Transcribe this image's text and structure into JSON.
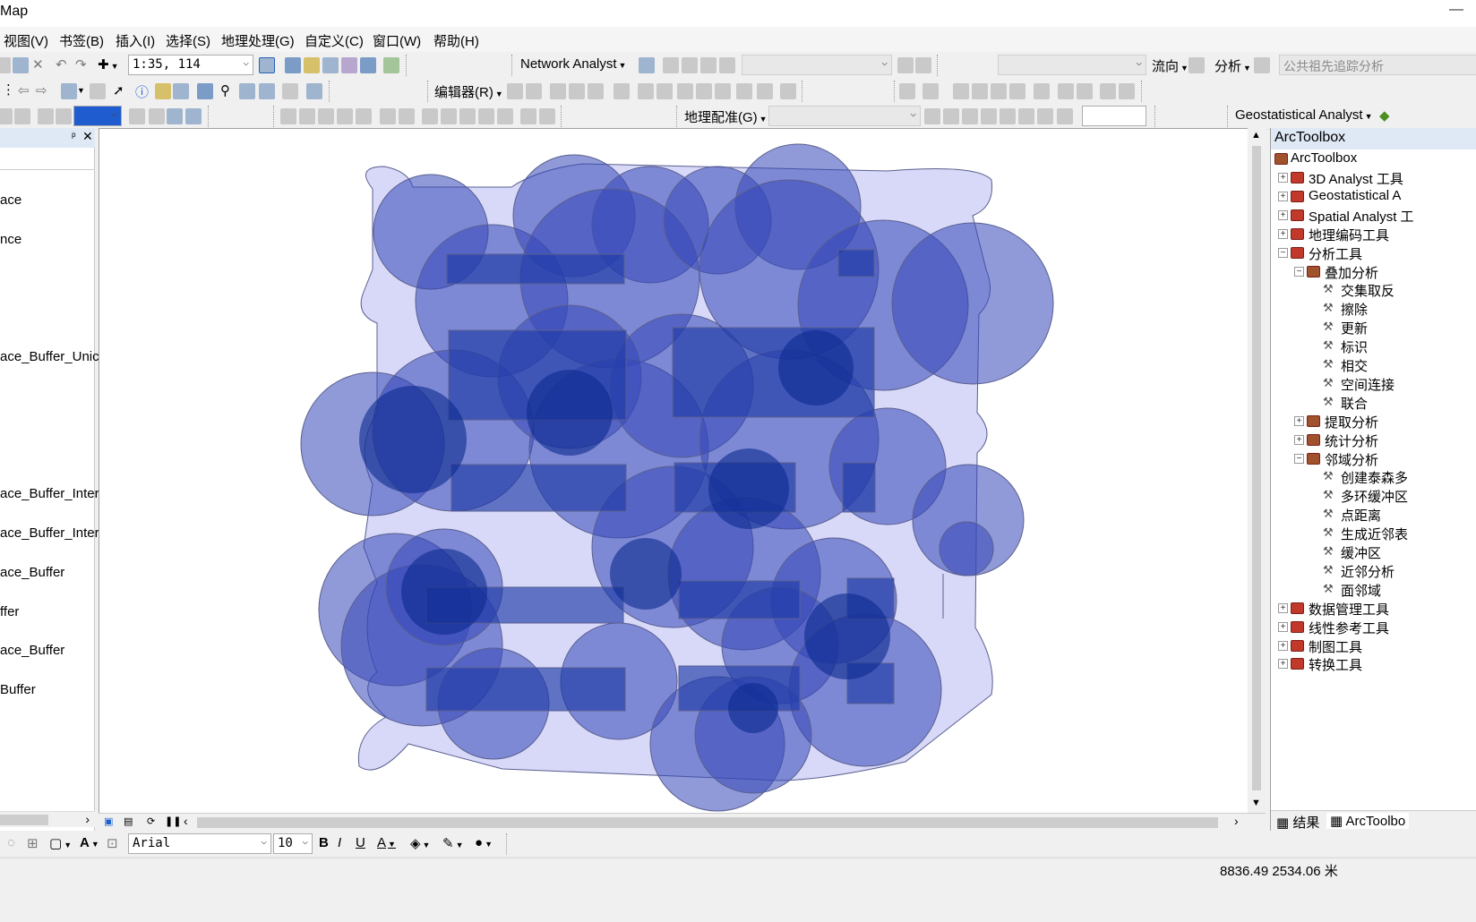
{
  "titlebar": {
    "title": "Map",
    "min_icon": "minimize-icon"
  },
  "menu": [
    "视图(V)",
    "书签(B)",
    "插入(I)",
    "选择(S)",
    "地理处理(G)",
    "自定义(C)",
    "窗口(W)",
    "帮助(H)"
  ],
  "toolbar1": {
    "scale": "1:35, 114",
    "network_analyst": "Network Analyst",
    "flow": "流向",
    "analysis": "分析",
    "trace": "公共祖先追踪分析"
  },
  "toolbar2": {
    "editor": "编辑器(R)"
  },
  "toolbar3": {
    "georef": "地理配准(G)",
    "geostat": "Geostatistical Analyst"
  },
  "toc": {
    "pin": "ᵖ",
    "close": "✕",
    "layers": [
      "ace",
      "nce",
      "ace_Buffer_Unic",
      "ace_Buffer_Inter",
      "ace_Buffer_Inter",
      "ace_Buffer",
      "ffer",
      "ace_Buffer",
      "Buffer"
    ]
  },
  "toolbox": {
    "header": "ArcToolbox",
    "root": "ArcToolbox",
    "items": [
      {
        "label": "3D Analyst 工具",
        "level": 1,
        "expander": "+"
      },
      {
        "label": "Geostatistical A",
        "level": 1,
        "expander": "+"
      },
      {
        "label": "Spatial Analyst 工",
        "level": 1,
        "expander": "+"
      },
      {
        "label": "地理编码工具",
        "level": 1,
        "expander": "+"
      },
      {
        "label": "分析工具",
        "level": 1,
        "expander": "−"
      },
      {
        "label": "叠加分析",
        "level": 2,
        "expander": "−"
      },
      {
        "label": "交集取反",
        "level": 3,
        "expander": ""
      },
      {
        "label": "擦除",
        "level": 3,
        "expander": ""
      },
      {
        "label": "更新",
        "level": 3,
        "expander": ""
      },
      {
        "label": "标识",
        "level": 3,
        "expander": ""
      },
      {
        "label": "相交",
        "level": 3,
        "expander": ""
      },
      {
        "label": "空间连接",
        "level": 3,
        "expander": ""
      },
      {
        "label": "联合",
        "level": 3,
        "expander": ""
      },
      {
        "label": "提取分析",
        "level": 2,
        "expander": "+"
      },
      {
        "label": "统计分析",
        "level": 2,
        "expander": "+"
      },
      {
        "label": "邻域分析",
        "level": 2,
        "expander": "−"
      },
      {
        "label": "创建泰森多",
        "level": 3,
        "expander": ""
      },
      {
        "label": "多环缓冲区",
        "level": 3,
        "expander": ""
      },
      {
        "label": "点距离",
        "level": 3,
        "expander": ""
      },
      {
        "label": "生成近邻表",
        "level": 3,
        "expander": ""
      },
      {
        "label": "缓冲区",
        "level": 3,
        "expander": ""
      },
      {
        "label": "近邻分析",
        "level": 3,
        "expander": ""
      },
      {
        "label": "面邻域",
        "level": 3,
        "expander": ""
      },
      {
        "label": "数据管理工具",
        "level": 1,
        "expander": "+"
      },
      {
        "label": "线性参考工具",
        "level": 1,
        "expander": "+"
      },
      {
        "label": "制图工具",
        "level": 1,
        "expander": "+"
      },
      {
        "label": "转换工具",
        "level": 1,
        "expander": "+"
      }
    ],
    "tabs": [
      "结果",
      "ArcToolbo"
    ]
  },
  "drawbar": {
    "font": "Arial",
    "size": "10",
    "bold": "B",
    "italic": "I",
    "underline": "U",
    "text_tool": "A"
  },
  "status": {
    "coords": "8836.49  2534.06 米"
  },
  "colors": {
    "buffer_fill": "#3447b8",
    "footprint_fill": "#d8d9f8",
    "outline": "#5a5f8f"
  }
}
